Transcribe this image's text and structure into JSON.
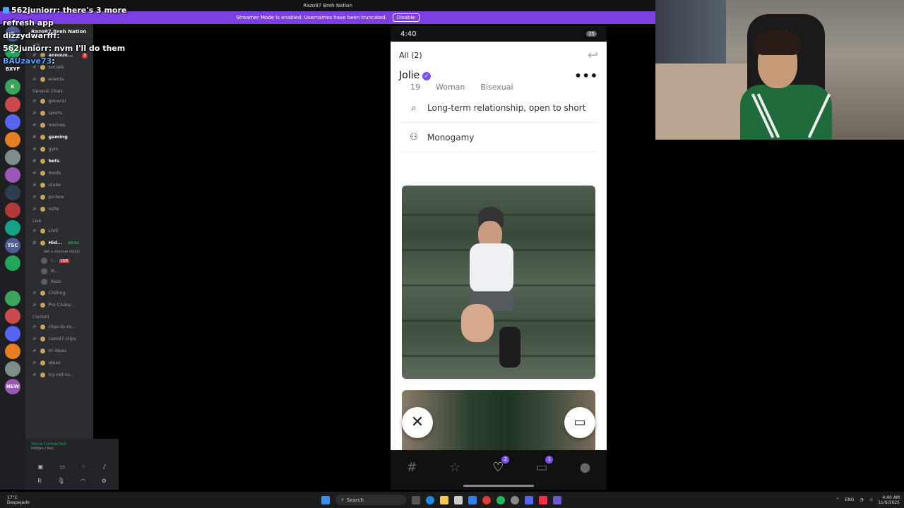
{
  "window": {
    "title": "Razo97 Breh Nation",
    "streamer_notice": "Streamer Mode is enabled. Usernames have been truncated.",
    "disable_label": "Disable"
  },
  "chat": [
    {
      "user": "562juniorr",
      "text": ": there's 3 more"
    },
    {
      "user": "",
      "text": "refresh app"
    },
    {
      "user": "dizzydwarfff",
      "text": ":"
    },
    {
      "user": "562juniorr",
      "text": ": nvm I'll do them"
    },
    {
      "user": "BAUzave73",
      "text": ":"
    }
  ],
  "discord": {
    "server_name": "Razo97 Breh Nation",
    "rail": [
      "R",
      "B",
      "BXYF",
      "K",
      "",
      "",
      "",
      "",
      "",
      "",
      "",
      "",
      "TSC",
      "",
      "",
      "",
      "",
      "",
      "",
      "",
      "NEW"
    ],
    "channels_top": [
      {
        "label": "info",
        "kind": "cat"
      },
      {
        "label": "announ...",
        "active": true,
        "badge": "2"
      },
      {
        "label": "socials"
      },
      {
        "label": "events"
      }
    ],
    "general_cat": "General Chats",
    "general": [
      {
        "label": "general"
      },
      {
        "label": "sports"
      },
      {
        "label": "memes"
      },
      {
        "label": "gaming",
        "active": true
      },
      {
        "label": "gym"
      },
      {
        "label": "bets",
        "active": true
      },
      {
        "label": "mods"
      },
      {
        "label": "stake"
      },
      {
        "label": "po-box"
      },
      {
        "label": "nsfw"
      }
    ],
    "live_cat": "Live",
    "live": [
      {
        "label": "LIVE"
      },
      {
        "label": "Hid...",
        "time": "04:02",
        "active": true
      }
    ],
    "channel_status": "Set a channel status",
    "voice_users": [
      {
        "name": "r...",
        "live": "LIVE"
      },
      {
        "name": "M..."
      },
      {
        "name": "Razo"
      }
    ],
    "voice_channels": [
      {
        "label": "Chilling"
      },
      {
        "label": "Pro Clubs/..."
      }
    ],
    "content_cat": "Content",
    "content": [
      {
        "label": "clips-to-re..."
      },
      {
        "label": "razo97-clips"
      },
      {
        "label": "irl-ideas"
      },
      {
        "label": "ideas"
      },
      {
        "label": "try-not-to..."
      }
    ],
    "voice_connected": "Voice Connected",
    "voice_sub": "Hidden / Raz...",
    "user_short": "R"
  },
  "phone": {
    "time": "4:40",
    "battery": "25",
    "all_label": "All (2)",
    "name": "Jolie",
    "tags": [
      "19",
      "Woman",
      "Bisexual"
    ],
    "looking_for": "Long-term relationship, open to short",
    "relationship_type": "Monogamy",
    "nav_likes_count": "2",
    "nav_chats_count": "1"
  },
  "taskbar": {
    "weather_temp": "17°C",
    "weather_desc": "Despejado",
    "search_label": "Search",
    "lang": "ENG",
    "time": "4:40 AM",
    "date": "11/6/2025"
  },
  "colors": {
    "streamer_bar": "#7b3fe4",
    "accent": "#7c4dff",
    "discord_bg": "#2b2d31"
  }
}
